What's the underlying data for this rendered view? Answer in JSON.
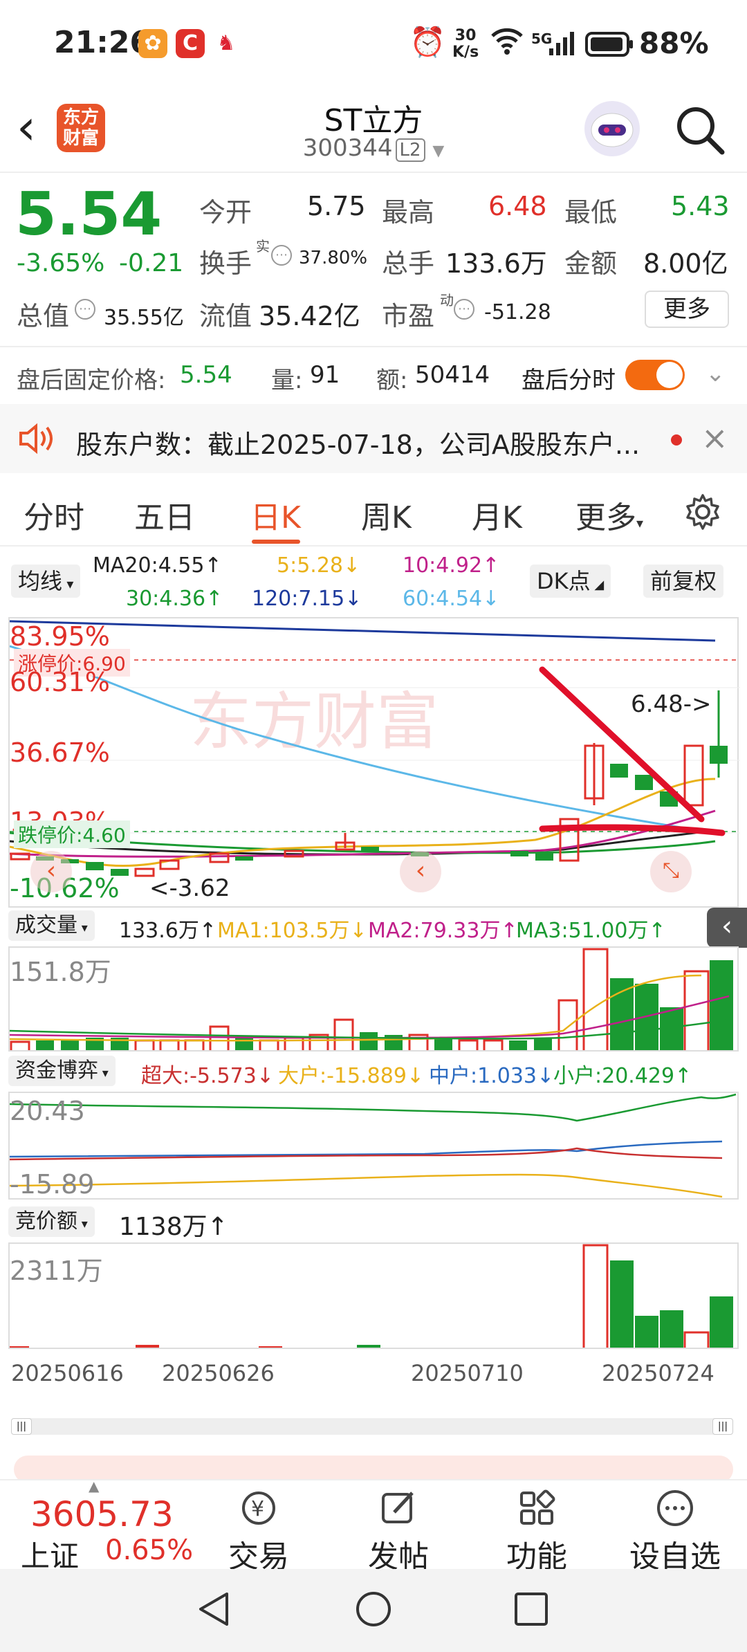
{
  "status": {
    "time": "21:26",
    "speed_top": "30",
    "speed_bot": "K/s",
    "net": "5G",
    "battery": "88%"
  },
  "header": {
    "title": "ST立方",
    "code": "300344",
    "l2": "L2",
    "logo_line1": "东方",
    "logo_line2": "财富"
  },
  "quote": {
    "price": "5.54",
    "change_pct": "-3.65%",
    "change": "-0.21",
    "open_label": "今开",
    "open": "5.75",
    "high_label": "最高",
    "high": "6.48",
    "low_label": "最低",
    "low": "5.43",
    "turnover_label": "换手",
    "turnover_sup": "实",
    "turnover": "37.80%",
    "vol_label": "总手",
    "vol": "133.6万",
    "amount_label": "金额",
    "amount": "8.00亿",
    "mcap_label": "总值",
    "mcap": "35.55亿",
    "float_label": "流值",
    "float": "35.42亿",
    "pe_label": "市盈",
    "pe_sup": "动",
    "pe": "-51.28",
    "more": "更多"
  },
  "afterhours": {
    "price_label": "盘后固定价格:",
    "price": "5.54",
    "vol_label": "量:",
    "vol": "91",
    "amt_label": "额:",
    "amt": "50414",
    "toggle_label": "盘后分时"
  },
  "notice": {
    "text": "股东户数：截止2025-07-18，公司A股股东户..."
  },
  "tabs": [
    "分时",
    "五日",
    "日K",
    "周K",
    "月K",
    "更多"
  ],
  "active_tab": "日K",
  "ma": {
    "label": "均线",
    "ma20": "MA20:4.55↑",
    "ma5": "5:5.28↓",
    "ma10": "10:4.92↑",
    "ma30": "30:4.36↑",
    "ma120": "120:7.15↓",
    "ma60": "60:4.54↓",
    "dk": "DK点",
    "adjust": "前复权"
  },
  "kline": {
    "pct_top": "83.95%",
    "limit_up": "涨停价:6.90",
    "pct_2": "60.31%",
    "pct_3": "36.67%",
    "pct_4": "13.03%",
    "limit_down": "跌停价:4.60",
    "pct_bot": "-10.62%",
    "hi_marker": "6.48->",
    "lo_marker": "<-3.62"
  },
  "volume": {
    "label": "成交量",
    "value": "133.6万↑",
    "ma1": "MA1:103.5万↓",
    "ma2": "MA2:79.33万↑",
    "ma3": "MA3:51.00万↑",
    "axis": "151.8万"
  },
  "fund": {
    "label": "资金博弈",
    "super": "超大:-5.573↓",
    "large": "大户:-15.889↓",
    "mid": "中户:1.033↓",
    "small": "小户:20.429↑",
    "axis_top": "20.43",
    "axis_bot": "-15.89"
  },
  "auction": {
    "label": "竞价额",
    "value": "1138万↑",
    "axis": "2311万"
  },
  "dates": [
    "20250616",
    "20250626",
    "20250710",
    "20250724"
  ],
  "nav": {
    "index_value": "3605.73",
    "index_name": "上证",
    "index_change": "0.65%",
    "items": [
      "交易",
      "发帖",
      "功能",
      "设自选"
    ]
  },
  "colors": {
    "up": "#e0302a",
    "down": "#1a9a32",
    "accent": "#e8542a"
  }
}
